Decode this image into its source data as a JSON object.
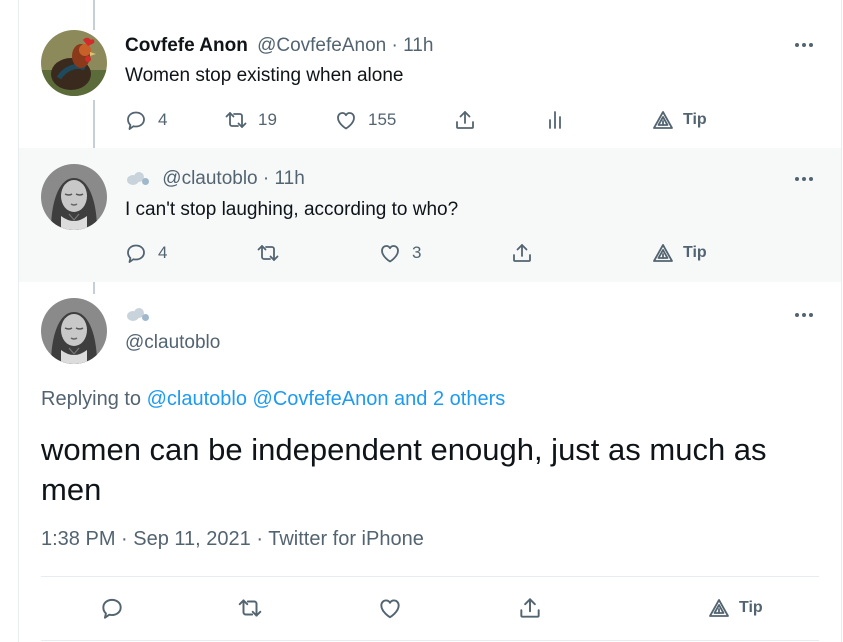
{
  "tweets": [
    {
      "author_name": "Covfefe Anon",
      "handle": "@CovfefeAnon",
      "separator": " · ",
      "time": "11h",
      "text": "Women stop existing when alone",
      "replies": "4",
      "retweets": "19",
      "likes": "155",
      "tip": "Tip"
    },
    {
      "author_name": "",
      "handle": "@clautoblo",
      "separator": " · ",
      "time": "11h",
      "text": "I can't stop laughing, according to who?",
      "replies": "4",
      "retweets": "",
      "likes": "3",
      "tip": "Tip"
    }
  ],
  "main_tweet": {
    "handle": "@clautoblo",
    "replying_prefix": "Replying to ",
    "replying_mentions": "@clautoblo @CovfefeAnon and 2 others",
    "text": "women can be independent enough, just as much as men",
    "time": "1:38 PM",
    "separator1": " · ",
    "date": "Sep 11, 2021",
    "separator2": " · ",
    "source": "Twitter for iPhone",
    "tip": "Tip"
  },
  "icons": {
    "reply": "reply-icon",
    "retweet": "retweet-icon",
    "like": "heart-icon",
    "share": "share-icon",
    "analytics": "analytics-icon",
    "tip": "tip-icon",
    "more": "more-icon"
  },
  "colors": {
    "link": "#1d9bf0",
    "secondary_text": "#536471",
    "highlight_bg": "#f7f9f9"
  }
}
